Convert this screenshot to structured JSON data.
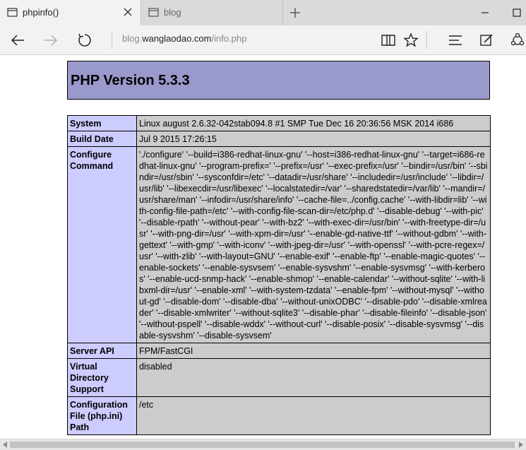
{
  "browser": {
    "tabs": [
      {
        "label": "phpinfo()",
        "active": true
      },
      {
        "label": "blog",
        "active": false
      }
    ],
    "url": {
      "host_prefix": "blog.",
      "host": "wanglaodao.com",
      "path": "/info.php"
    }
  },
  "page": {
    "title": "PHP Version 5.3.3",
    "rows": [
      {
        "key": "System",
        "value": "Linux august 2.6.32-042stab094.8 #1 SMP Tue Dec 16 20:36:56 MSK 2014 i686"
      },
      {
        "key": "Build Date",
        "value": "Jul 9 2015 17:26:15"
      },
      {
        "key": "Configure Command",
        "value": "'./configure' '--build=i386-redhat-linux-gnu' '--host=i386-redhat-linux-gnu' '--target=i686-redhat-linux-gnu' '--program-prefix=' '--prefix=/usr' '--exec-prefix=/usr' '--bindir=/usr/bin' '--sbindir=/usr/sbin' '--sysconfdir=/etc' '--datadir=/usr/share' '--includedir=/usr/include' '--libdir=/usr/lib' '--libexecdir=/usr/libexec' '--localstatedir=/var' '--sharedstatedir=/var/lib' '--mandir=/usr/share/man' '--infodir=/usr/share/info' '--cache-file=../config.cache' '--with-libdir=lib' '--with-config-file-path=/etc' '--with-config-file-scan-dir=/etc/php.d' '--disable-debug' '--with-pic' '--disable-rpath' '--without-pear' '--with-bz2' '--with-exec-dir=/usr/bin' '--with-freetype-dir=/usr' '--with-png-dir=/usr' '--with-xpm-dir=/usr' '--enable-gd-native-ttf' '--without-gdbm' '--with-gettext' '--with-gmp' '--with-iconv' '--with-jpeg-dir=/usr' '--with-openssl' '--with-pcre-regex=/usr' '--with-zlib' '--with-layout=GNU' '--enable-exif' '--enable-ftp' '--enable-magic-quotes' '--enable-sockets' '--enable-sysvsem' '--enable-sysvshm' '--enable-sysvmsg' '--with-kerberos' '--enable-ucd-snmp-hack' '--enable-shmop' '--enable-calendar' '--without-sqlite' '--with-libxml-dir=/usr' '--enable-xml' '--with-system-tzdata' '--enable-fpm' '--without-mysql' '--without-gd' '--disable-dom' '--disable-dba' '--without-unixODBC' '--disable-pdo' '--disable-xmlreader' '--disable-xmlwriter' '--without-sqlite3' '--disable-phar' '--disable-fileinfo' '--disable-json' '--without-pspell' '--disable-wddx' '--without-curl' '--disable-posix' '--disable-sysvmsg' '--disable-sysvshm' '--disable-sysvsem'"
      },
      {
        "key": "Server API",
        "value": "FPM/FastCGI"
      },
      {
        "key": "Virtual Directory Support",
        "value": "disabled"
      },
      {
        "key": "Configuration File (php.ini) Path",
        "value": "/etc"
      }
    ]
  },
  "colors": {
    "header_bg": "#9999cc",
    "key_bg": "#ccccff",
    "value_bg": "#cccccc"
  },
  "icons": {
    "tab": "page-icon",
    "close": "close-icon",
    "new_tab": "plus-icon",
    "minimize": "minimize-icon",
    "maximize": "maximize-icon",
    "back": "back-arrow-icon",
    "forward": "forward-arrow-icon",
    "refresh": "refresh-icon",
    "reading_view": "book-icon",
    "favorite": "star-icon",
    "hub": "hub-icon",
    "notes": "note-pen-icon",
    "share": "share-icon"
  }
}
